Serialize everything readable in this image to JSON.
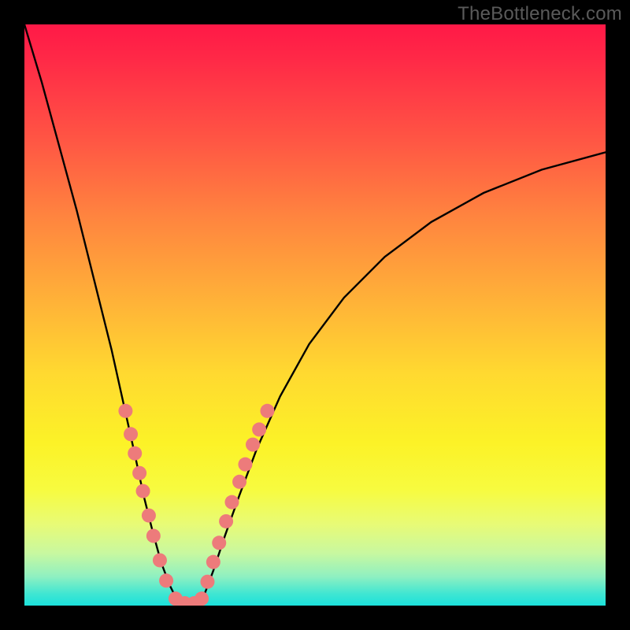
{
  "watermark": "TheBottleneck.com",
  "chart_data": {
    "type": "line",
    "title": "",
    "xlabel": "",
    "ylabel": "",
    "xlim": [
      0,
      1
    ],
    "ylim": [
      0,
      1
    ],
    "note": "Axes unlabeled; values are normalized plot coordinates (0–1) estimated from pixels. x is horizontal position, y is curve height (0 = bottom/green, 1 = top/red). Background gradient encodes y from green (low) to red (high).",
    "series": [
      {
        "name": "left-branch",
        "x": [
          0.0,
          0.03,
          0.06,
          0.09,
          0.12,
          0.15,
          0.17,
          0.19,
          0.205,
          0.22,
          0.235,
          0.25,
          0.26,
          0.27
        ],
        "y": [
          1.0,
          0.9,
          0.79,
          0.68,
          0.56,
          0.44,
          0.35,
          0.26,
          0.19,
          0.13,
          0.075,
          0.035,
          0.015,
          0.0
        ]
      },
      {
        "name": "valley-floor",
        "x": [
          0.27,
          0.285,
          0.3
        ],
        "y": [
          0.0,
          0.0,
          0.0
        ]
      },
      {
        "name": "right-branch",
        "x": [
          0.3,
          0.31,
          0.325,
          0.345,
          0.37,
          0.4,
          0.44,
          0.49,
          0.55,
          0.62,
          0.7,
          0.79,
          0.89,
          1.0
        ],
        "y": [
          0.0,
          0.02,
          0.06,
          0.12,
          0.19,
          0.27,
          0.36,
          0.45,
          0.53,
          0.6,
          0.66,
          0.71,
          0.75,
          0.78
        ]
      }
    ],
    "markers": {
      "note": "Salmon circular markers overlaid on the curve near the valley (lower ~35% of y).",
      "color": "#ed7b7b",
      "radius_px": 9,
      "points": [
        {
          "x": 0.174,
          "y": 0.335
        },
        {
          "x": 0.183,
          "y": 0.295
        },
        {
          "x": 0.19,
          "y": 0.262
        },
        {
          "x": 0.198,
          "y": 0.228
        },
        {
          "x": 0.204,
          "y": 0.197
        },
        {
          "x": 0.214,
          "y": 0.155
        },
        {
          "x": 0.222,
          "y": 0.12
        },
        {
          "x": 0.233,
          "y": 0.078
        },
        {
          "x": 0.244,
          "y": 0.043
        },
        {
          "x": 0.26,
          "y": 0.012
        },
        {
          "x": 0.276,
          "y": 0.004
        },
        {
          "x": 0.292,
          "y": 0.004
        },
        {
          "x": 0.305,
          "y": 0.012
        },
        {
          "x": 0.315,
          "y": 0.041
        },
        {
          "x": 0.325,
          "y": 0.075
        },
        {
          "x": 0.335,
          "y": 0.108
        },
        {
          "x": 0.347,
          "y": 0.145
        },
        {
          "x": 0.357,
          "y": 0.178
        },
        {
          "x": 0.37,
          "y": 0.213
        },
        {
          "x": 0.38,
          "y": 0.243
        },
        {
          "x": 0.393,
          "y": 0.277
        },
        {
          "x": 0.404,
          "y": 0.303
        },
        {
          "x": 0.418,
          "y": 0.335
        }
      ]
    },
    "gradient_scale": {
      "0.00": "#1be1db",
      "0.05": "#3fe6d2",
      "0.10": "#8ff0c1",
      "0.15": "#c8f8a0",
      "0.22": "#e8fb76",
      "0.30": "#f7fb3f",
      "0.40": "#fcf227",
      "0.55": "#ffd930",
      "0.70": "#ffb338",
      "0.82": "#ff843f",
      "0.92": "#ff5644",
      "1.00": "#ff1947"
    }
  }
}
